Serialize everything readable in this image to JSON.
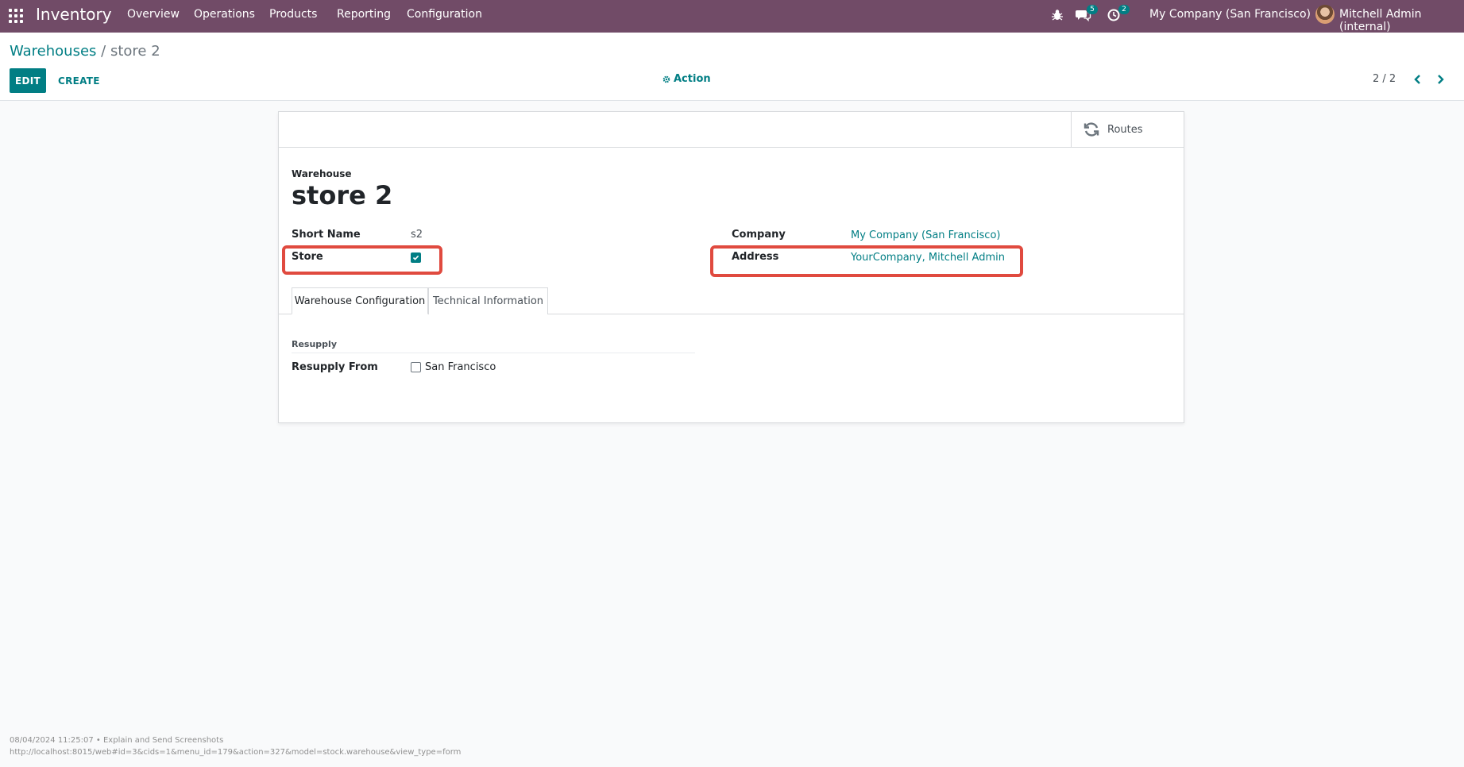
{
  "navbar": {
    "app_name": "Inventory",
    "menus": [
      "Overview",
      "Operations",
      "Products",
      "Reporting",
      "Configuration"
    ],
    "messages_count": "5",
    "activities_count": "2",
    "company": "My Company (San Francisco)",
    "user": "Mitchell Admin (internal)",
    "bg_color": "#714b67"
  },
  "breadcrumb": {
    "parent": "Warehouses",
    "separator": "/",
    "current": "store 2"
  },
  "control_panel": {
    "edit_label": "EDIT",
    "create_label": "CREATE",
    "action_label": "Action",
    "pager": "2 / 2"
  },
  "form": {
    "routes_label": "Routes",
    "title_caption": "Warehouse",
    "name": "store 2",
    "short_name_label": "Short Name",
    "short_name_value": "s2",
    "store_label": "Store",
    "store_checked": true,
    "company_label": "Company",
    "company_value": "My Company (San Francisco)",
    "address_label": "Address",
    "address_value": "YourCompany, Mitchell Admin",
    "tabs": [
      "Warehouse Configuration",
      "Technical Information"
    ],
    "resupply_group_title": "Resupply",
    "resupply_from_label": "Resupply From",
    "resupply_option": "San Francisco",
    "resupply_checked": false
  },
  "footer": {
    "line1": "08/04/2024 11:25:07 • Explain and Send Screenshots",
    "line2": "http://localhost:8015/web#id=3&cids=1&menu_id=179&action=327&model=stock.warehouse&view_type=form"
  },
  "colors": {
    "accent": "#017e84",
    "highlight": "#e04a3f"
  }
}
